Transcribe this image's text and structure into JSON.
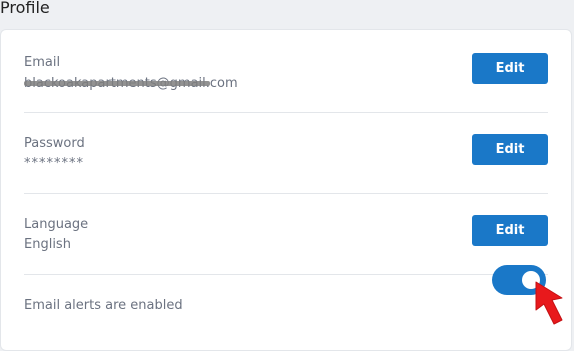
{
  "page": {
    "title": "Profile"
  },
  "profile": {
    "email": {
      "label": "Email",
      "value": "blackoakapartments@gmail.com",
      "edit_label": "Edit"
    },
    "password": {
      "label": "Password",
      "value": "********",
      "edit_label": "Edit"
    },
    "language": {
      "label": "Language",
      "value": "English",
      "edit_label": "Edit"
    },
    "email_alerts": {
      "label": "Email alerts are enabled",
      "enabled": true
    }
  },
  "colors": {
    "accent": "#1a78c8",
    "annotation_arrow": "#e8191c"
  },
  "icons": {
    "annotation": "red-arrow-icon"
  }
}
